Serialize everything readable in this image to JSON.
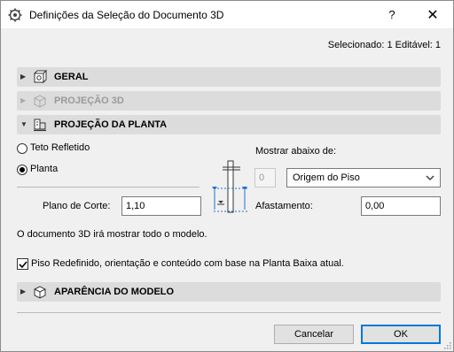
{
  "window": {
    "title": "Definições da Seleção do Documento 3D",
    "help_label": "?",
    "close_label": "✕"
  },
  "selection_info": "Selecionado: 1 Editável: 1",
  "sections": {
    "geral": "GERAL",
    "projecao3d": "PROJEÇÃO 3D",
    "projecao_planta": "PROJEÇÃO DA PLANTA",
    "aparencia": "APARÊNCIA DO MODELO"
  },
  "planta_panel": {
    "radio_teto": "Teto Refletido",
    "radio_planta": "Planta",
    "selected_radio": "Planta",
    "plano_corte_label": "Plano de Corte:",
    "plano_corte_value": "1,10",
    "mostrar_label": "Mostrar abaixo de:",
    "story_index_value": "0",
    "story_select_value": "Origem do Piso",
    "afastamento_label": "Afastamento:",
    "afastamento_value": "0,00"
  },
  "model_info": "O documento 3D irá mostrar todo o modelo.",
  "floor_checkbox": {
    "checked": true,
    "label": "Piso Redefinido, orientação e conteúdo com base na Planta Baixa atual."
  },
  "buttons": {
    "cancel": "Cancelar",
    "ok": "OK"
  },
  "colors": {
    "section_bg": "#dcdcdc",
    "window_bg": "#f0f0f0",
    "default_button_border": "#0078d7",
    "diagram_accent": "#1e6fd9"
  }
}
